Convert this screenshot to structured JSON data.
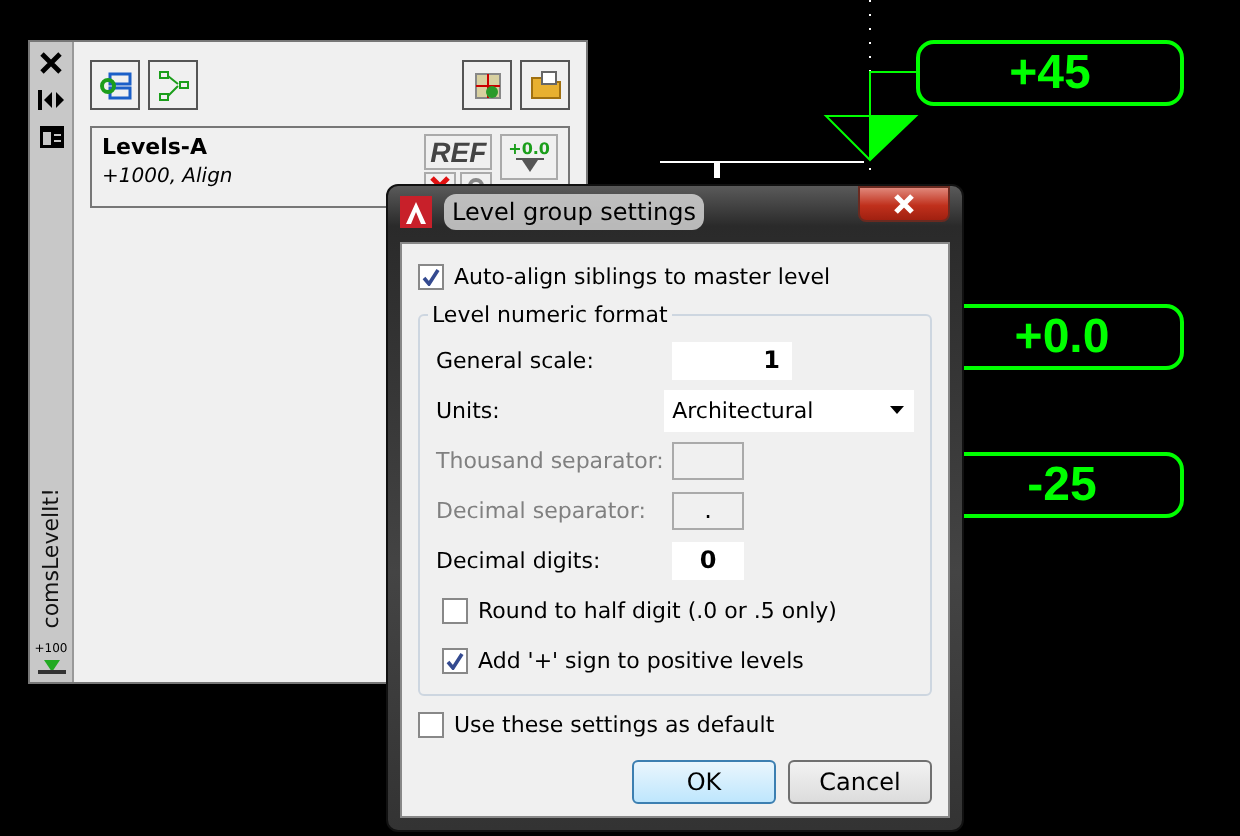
{
  "canvas": {
    "tags": [
      {
        "text": "+45",
        "kind": "full"
      },
      {
        "text": "+0.0",
        "kind": "cut"
      },
      {
        "text": "-25",
        "kind": "cut"
      }
    ]
  },
  "palette": {
    "title": "comsLevelIt!",
    "footer_badge": "+100",
    "item": {
      "name": "Levels-A",
      "subtitle": "+1000, Align",
      "badge": "REF",
      "level_label": "+0.0"
    }
  },
  "dialog": {
    "title": "Level group settings",
    "auto_align": {
      "label": "Auto-align siblings to master level",
      "checked": true
    },
    "group_title": "Level numeric format",
    "fields": [
      {
        "label": "General scale:",
        "value": "1",
        "kind": "input",
        "disabled": false
      },
      {
        "label": "Units:",
        "value": "Architectural",
        "kind": "select",
        "disabled": false
      },
      {
        "label": "Thousand separator:",
        "kind": "small",
        "disabled": true
      },
      {
        "label": "Decimal separator:",
        "value": ".",
        "kind": "small",
        "disabled": true
      },
      {
        "label": "Decimal digits:",
        "value": "0",
        "kind": "small",
        "disabled": false
      }
    ],
    "options": [
      {
        "label": "Round to half digit (.0 or .5 only)",
        "checked": false
      },
      {
        "label": "Add '+' sign to positive levels",
        "checked": true
      }
    ],
    "use_default": {
      "label": "Use these settings as default",
      "checked": false
    },
    "buttons": [
      {
        "label": "OK",
        "kind": "default"
      },
      {
        "label": "Cancel",
        "kind": "normal"
      }
    ]
  }
}
